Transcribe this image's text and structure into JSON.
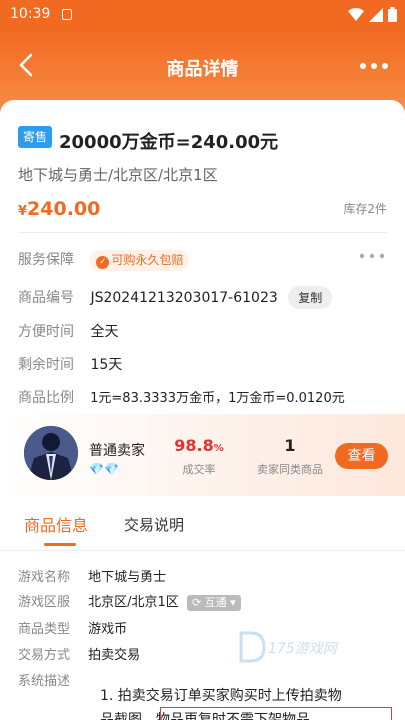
{
  "status_bar": {
    "time": "10:39"
  },
  "header": {
    "title": "商品详情",
    "back_icon": "chevron-left-icon",
    "more_icon": "more-dots-icon"
  },
  "product": {
    "tag": "寄售",
    "title": "20000万金币=240.00元",
    "area": "地下城与勇士/北京区/北京1区",
    "currency": "¥",
    "price": "240.00",
    "stock": "库存2件"
  },
  "details": {
    "service": {
      "label": "服务保障",
      "value": "可购永久包赔",
      "icon": "check-icon"
    },
    "code": {
      "label": "商品编号",
      "value": "JS20241213203017-61023",
      "copy": "复制"
    },
    "time": {
      "label": "方便时间",
      "value": "全天"
    },
    "remain": {
      "label": "剩余时间",
      "value": "15天"
    },
    "ratio": {
      "label": "商品比例",
      "value": "1元=83.3333万金币，1万金币=0.0120元"
    }
  },
  "seller": {
    "name": "普通卖家",
    "diamonds": "💎💎",
    "rate_num": "98.8",
    "rate_unit": "%",
    "rate_label": "成交率",
    "count": "1",
    "count_label": "卖家同类商品",
    "view": "查看"
  },
  "tabs": [
    {
      "label": "商品信息",
      "active": true
    },
    {
      "label": "交易说明",
      "active": false
    }
  ],
  "info": {
    "game": {
      "label": "游戏名称",
      "value": "地下城与勇士"
    },
    "server": {
      "label": "游戏区服",
      "value": "北京区/北京1区",
      "switch": "互通"
    },
    "type": {
      "label": "商品类型",
      "value": "游戏币"
    },
    "trade": {
      "label": "交易方式",
      "value": "拍卖交易"
    },
    "sys": {
      "label": "系统描述"
    }
  },
  "description": {
    "line1": "1. 拍卖交易订单买家购买时上传拍卖物",
    "line2": "品截图，物品再复时不需下架物品"
  },
  "watermark": "175游戏网",
  "colors": {
    "accent": "#f26a21",
    "tag_blue": "#2d9cf0",
    "rate_red": "#e5322d"
  }
}
